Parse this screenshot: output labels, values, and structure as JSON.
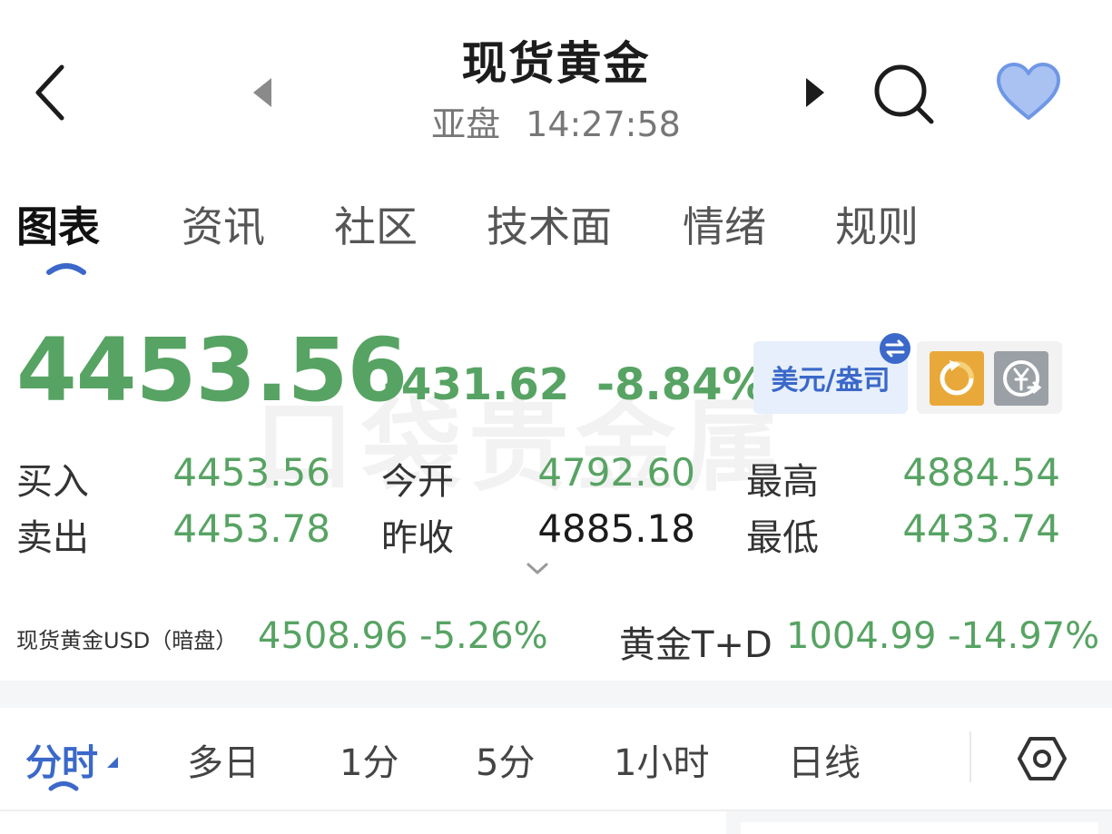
{
  "header": {
    "title": "现货黄金",
    "session": "亚盘",
    "time": "14:27:58",
    "colors": {
      "heart": "#7aa0e8",
      "text": "#1c1c1c"
    }
  },
  "tabs": [
    {
      "label": "图表",
      "active": true
    },
    {
      "label": "资讯"
    },
    {
      "label": "社区"
    },
    {
      "label": "技术面"
    },
    {
      "label": "情绪"
    },
    {
      "label": "规则"
    }
  ],
  "quote": {
    "price": "4453.56",
    "change": "-431.62",
    "change_pct": "-8.84%",
    "currency_label": "美元/盎司",
    "watermark": "口袋贵金属",
    "rows": [
      {
        "label": "买入",
        "value": "4453.56"
      },
      {
        "label": "今开",
        "value": "4792.60"
      },
      {
        "label": "最高",
        "value": "4884.54"
      },
      {
        "label": "卖出",
        "value": "4453.78"
      },
      {
        "label": "昨收",
        "value": "4885.18"
      },
      {
        "label": "最低",
        "value": "4433.74"
      }
    ],
    "colors": {
      "down": "#57a363",
      "accent": "#3b68c9"
    }
  },
  "related": [
    {
      "label": "现货黄金USD（暗盘）",
      "value": "4508.96",
      "pct": "-5.26%"
    },
    {
      "label": "黄金T+D",
      "value": "1004.99",
      "pct": "-14.97%"
    }
  ],
  "period_tabs": [
    {
      "label": "分时",
      "active": true
    },
    {
      "label": "多日"
    },
    {
      "label": "1分"
    },
    {
      "label": "5分"
    },
    {
      "label": "1小时"
    },
    {
      "label": "日线"
    }
  ]
}
